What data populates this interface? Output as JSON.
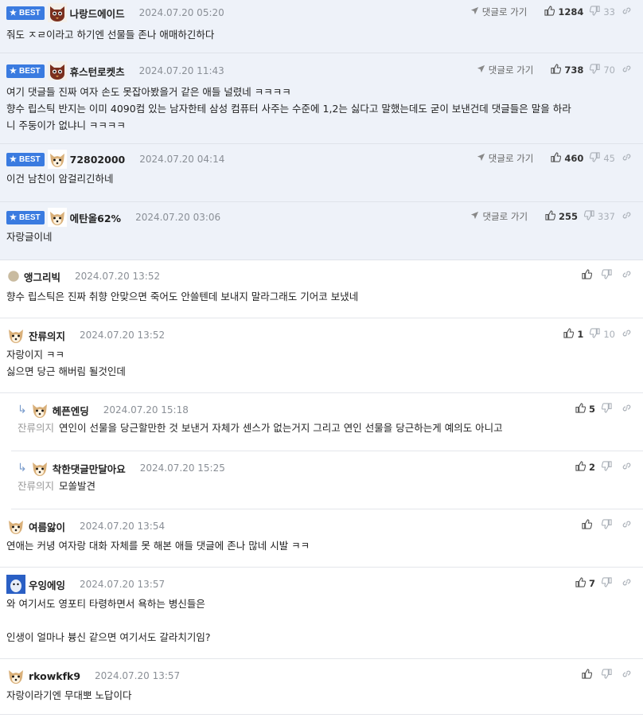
{
  "labels": {
    "best": "BEST",
    "goto": "댓글로 가기"
  },
  "comments": [
    {
      "best": true,
      "nick": "나랑드에이드",
      "date": "2024.07.20 05:20",
      "lines": [
        "줘도 ㅈㄹ이라고 하기엔 선물들 존나 애매하긴하다"
      ],
      "up": "1284",
      "down": "33",
      "avatar": "cat-avatar"
    },
    {
      "best": true,
      "nick": "휴스턴로켓츠",
      "date": "2024.07.20 11:43",
      "lines": [
        "여기 댓글들 진짜 여자 손도 못잡아봤을거 같은 애들 널렸네 ㅋㅋㅋㅋ",
        "향수 립스틱 반지는 이미 4090컴 있는 남자한테 삼성 컴퓨터 사주는 수준에 1,2는 싫다고 말했는데도 굳이 보낸건데 댓글들은 말을 하라",
        "니 주둥이가 없냐니 ㅋㅋㅋㅋ"
      ],
      "up": "738",
      "down": "70",
      "avatar": "cat-avatar"
    },
    {
      "best": true,
      "nick": "72802000",
      "date": "2024.07.20 04:14",
      "lines": [
        "이건 남친이 암걸리긴하네"
      ],
      "up": "460",
      "down": "45",
      "avatar": "dog-avatar"
    },
    {
      "best": true,
      "nick": "에탄올62%",
      "date": "2024.07.20 03:06",
      "lines": [
        "자랑글이네"
      ],
      "up": "255",
      "down": "337",
      "avatar": "dog-avatar"
    },
    {
      "best": false,
      "nick": "앵그리빅",
      "date": "2024.07.20 13:52",
      "lines": [
        "향수 립스틱은 진짜 취향 안맞으면 죽어도 안쓸텐데 보내지 말라그래도 기어코 보냈네"
      ],
      "up": "",
      "down": "",
      "avatar": "dot-avatar"
    },
    {
      "best": false,
      "nick": "잔류의지",
      "date": "2024.07.20 13:52",
      "lines": [
        "자랑이지 ㅋㅋ",
        "싫으면 당근 해버림 될것인데"
      ],
      "up": "1",
      "down": "10",
      "avatar": "dog-avatar"
    },
    {
      "best": false,
      "reply": true,
      "mention": "잔류의지",
      "nick": "헤픈엔딩",
      "date": "2024.07.20 15:18",
      "lines": [
        "연인이 선물을 당근할만한 것 보낸거 자체가 센스가 없는거지 그리고 연인 선물을 당근하는게 예의도 아니고"
      ],
      "up": "5",
      "down": "",
      "avatar": "dog-avatar"
    },
    {
      "best": false,
      "reply": true,
      "mention": "잔류의지",
      "nick": "착한댓글만달아요",
      "date": "2024.07.20 15:25",
      "lines": [
        "모쏠발견"
      ],
      "up": "2",
      "down": "",
      "avatar": "dog-avatar"
    },
    {
      "best": false,
      "nick": "여름앓이",
      "date": "2024.07.20 13:54",
      "lines": [
        "연애는 커녕 여자랑 대화 자체를 못 해본 애들 댓글에 존나 많네 시발 ㅋㅋ"
      ],
      "up": "",
      "down": "",
      "avatar": "dog-avatar"
    },
    {
      "best": false,
      "nick": "우잉에잉",
      "date": "2024.07.20 13:57",
      "lines": [
        "와 여기서도 영포티 타령하면서 욕하는 병신들은",
        "",
        "인생이 얼마나 븅신 같으면 여기서도 갈라치기임?"
      ],
      "up": "7",
      "down": "",
      "avatar": "blue-avatar"
    },
    {
      "best": false,
      "nick": "rkowkfk9",
      "date": "2024.07.20 13:57",
      "lines": [
        "자랑이라기엔 무대뽀 노답이다"
      ],
      "up": "",
      "down": "",
      "avatar": "dog-avatar"
    }
  ],
  "colors": {
    "best_bg": "#eef2f9",
    "badge": "#3a7be0"
  }
}
